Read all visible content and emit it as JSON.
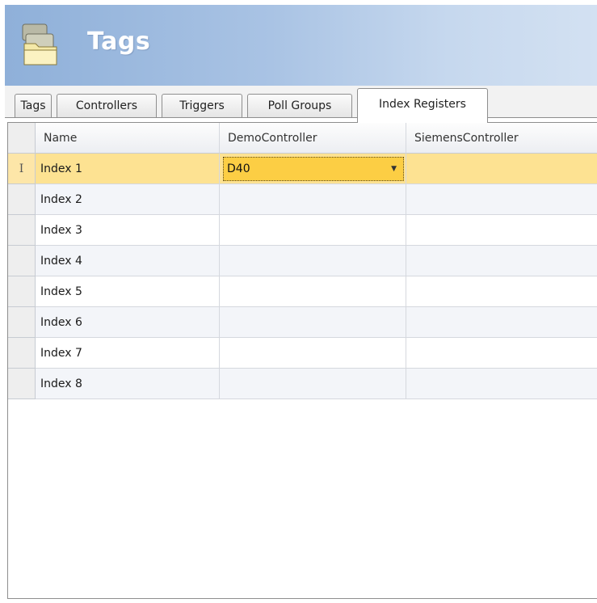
{
  "header": {
    "title": "Tags",
    "icon": "tags-folder-icon"
  },
  "tabs": [
    {
      "label": "Tags",
      "active": false
    },
    {
      "label": "Controllers",
      "active": false
    },
    {
      "label": "Triggers",
      "active": false
    },
    {
      "label": "Poll Groups",
      "active": false
    },
    {
      "label": "Index Registers",
      "active": true
    }
  ],
  "grid": {
    "columns": [
      "Name",
      "DemoController",
      "SiemensController"
    ],
    "selected_row_marker": "I",
    "editor": {
      "value": "D40",
      "dropdown_icon": "dropdown-arrow-icon"
    },
    "rows": [
      {
        "name": "Index 1",
        "demo": "D40",
        "siemens": ""
      },
      {
        "name": "Index 2",
        "demo": "",
        "siemens": ""
      },
      {
        "name": "Index 3",
        "demo": "",
        "siemens": ""
      },
      {
        "name": "Index 4",
        "demo": "",
        "siemens": ""
      },
      {
        "name": "Index 5",
        "demo": "",
        "siemens": ""
      },
      {
        "name": "Index 6",
        "demo": "",
        "siemens": ""
      },
      {
        "name": "Index 7",
        "demo": "",
        "siemens": ""
      },
      {
        "name": "Index 8",
        "demo": "",
        "siemens": ""
      }
    ]
  },
  "colors": {
    "header_gradient_start": "#8fb0d9",
    "header_gradient_end": "#d3e1f2",
    "selected_row": "#fde292",
    "editor_background": "#fcce44"
  }
}
